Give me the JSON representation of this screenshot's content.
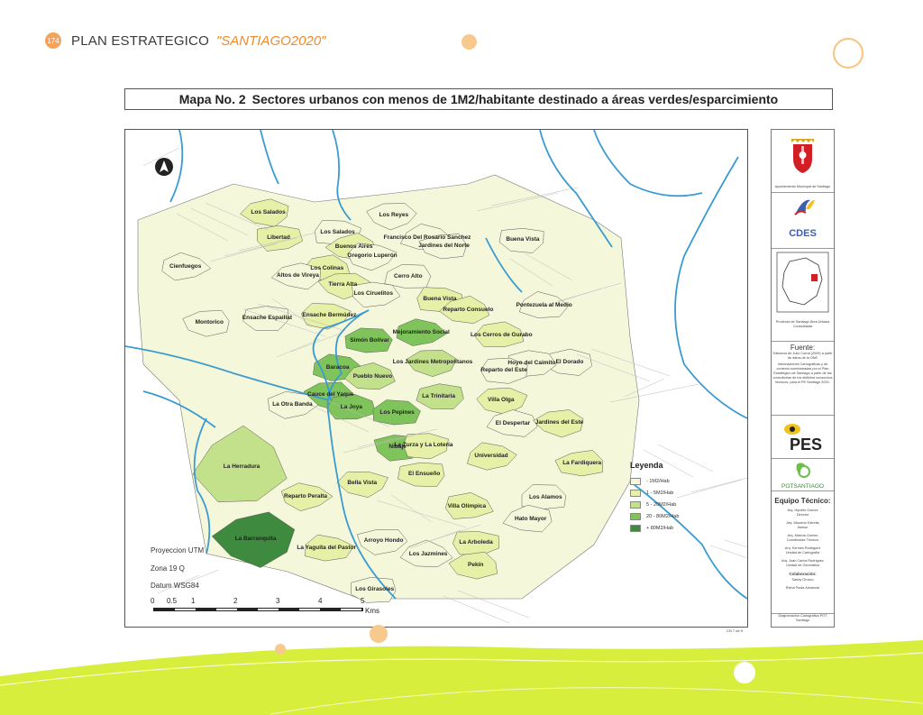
{
  "header": {
    "page_number": "174",
    "title": "PLAN ESTRATEGICO",
    "subtitle": "\"SANTIAGO2020\""
  },
  "map": {
    "title_number": "Mapa No. 2",
    "title_text": "Sectores urbanos con menos de 1M2/habitante destinado a áreas verdes/esparcimiento",
    "sectors": [
      {
        "name": "Los Salados",
        "level": 2
      },
      {
        "name": "Los Reyes",
        "level": 1
      },
      {
        "name": "Libertad",
        "level": 2
      },
      {
        "name": "Los Salados",
        "level": 1
      },
      {
        "name": "Francisco Del Rosario Sanchez",
        "level": 1
      },
      {
        "name": "Buenos Aires",
        "level": 2
      },
      {
        "name": "Jardines del Norte",
        "level": 1
      },
      {
        "name": "Buena Vista",
        "level": 1
      },
      {
        "name": "Gregorio Luperón",
        "level": 1
      },
      {
        "name": "Cienfuegos",
        "level": 1
      },
      {
        "name": "Los Colinas",
        "level": 2
      },
      {
        "name": "Cerro Alto",
        "level": 1
      },
      {
        "name": "Altos de Vireya",
        "level": 1
      },
      {
        "name": "Tierra Alta",
        "level": 2
      },
      {
        "name": "Los Ciruelitos",
        "level": 1
      },
      {
        "name": "Buena Vista",
        "level": 2
      },
      {
        "name": "Pontezuela al Medio",
        "level": 1
      },
      {
        "name": "Reparto Consuelo",
        "level": 2
      },
      {
        "name": "Montorico",
        "level": 1
      },
      {
        "name": "Ensache Espaillat",
        "level": 1
      },
      {
        "name": "Ensache Bermúdez",
        "level": 2
      },
      {
        "name": "Mejoramiento Social",
        "level": 4
      },
      {
        "name": "Los Cerros de Gurabo",
        "level": 2
      },
      {
        "name": "Simón Bolívar",
        "level": 4
      },
      {
        "name": "El Dorado",
        "level": 1
      },
      {
        "name": "Los Jardines Metropolitanos",
        "level": 3
      },
      {
        "name": "Hoyo del Caimito",
        "level": 1
      },
      {
        "name": "Reparto del Este",
        "level": 1
      },
      {
        "name": "Baracoa",
        "level": 4
      },
      {
        "name": "Pueblo Nuevo",
        "level": 3
      },
      {
        "name": "Cauce del Yaque",
        "level": 4
      },
      {
        "name": "La Trinitaria",
        "level": 3
      },
      {
        "name": "Villa Olga",
        "level": 2
      },
      {
        "name": "La Otra Banda",
        "level": 1
      },
      {
        "name": "La Joya",
        "level": 4
      },
      {
        "name": "Los Pepines",
        "level": 4
      },
      {
        "name": "El Despertar",
        "level": 1
      },
      {
        "name": "Jardines del Este",
        "level": 2
      },
      {
        "name": "Nibaje",
        "level": 4
      },
      {
        "name": "La Zurza y La Lotería",
        "level": 2
      },
      {
        "name": "Universidad",
        "level": 2
      },
      {
        "name": "La Herradura",
        "level": 3
      },
      {
        "name": "La Fardiquera",
        "level": 2
      },
      {
        "name": "El Ensueño",
        "level": 2
      },
      {
        "name": "Bella Vista",
        "level": 2
      },
      {
        "name": "Reparto Peralta",
        "level": 2
      },
      {
        "name": "Villa Olímpica",
        "level": 2
      },
      {
        "name": "Los Alamos",
        "level": 1
      },
      {
        "name": "Hato Mayor",
        "level": 1
      },
      {
        "name": "La Barranquita",
        "level": 5
      },
      {
        "name": "Arroyo Hondo",
        "level": 1
      },
      {
        "name": "La Arboleda",
        "level": 2
      },
      {
        "name": "La Yaguita del Pastor",
        "level": 2
      },
      {
        "name": "Los Jazmines",
        "level": 1
      },
      {
        "name": "Pekín",
        "level": 2
      },
      {
        "name": "Los Girasoles",
        "level": 1
      }
    ],
    "legend": {
      "title": "Leyenda",
      "items": [
        {
          "label": "- 1M2/Hab",
          "color": "#f4f7d9"
        },
        {
          "label": "1 - 5M2/Hab",
          "color": "#e6f0a6"
        },
        {
          "label": "5 - 20M2/Hab",
          "color": "#c3e08a"
        },
        {
          "label": "20 - 80M2/Hab",
          "color": "#7fc45a"
        },
        {
          "label": "+ 80M2/Hab",
          "color": "#3e8a3e"
        }
      ]
    },
    "projection": {
      "line1": "Proyeccion UTM",
      "line2": "Zona 19 Q",
      "line3": "Datum WSG84"
    },
    "scale": {
      "ticks": [
        "0",
        "0.5",
        "1",
        "2",
        "3",
        "4",
        "5"
      ],
      "unit": "Kms"
    },
    "credit": "CN 7 de 5"
  },
  "panel": {
    "logo1_caption": "Ayuntamiento Municipal de Santiago",
    "logo2_text": "CDES",
    "locator_caption": "Provincia de Santiago Área Urbana Consolidada",
    "fuente_title": "Fuente:",
    "fuente_text1": "Edesinos de Julio Corral (2009) a partir de datos de la ONE",
    "fuente_text2": "Informaciones Cartográficas y de contexto suministradas por el Plan Estratégico de Santiago a partir de las consultorías de los distintos consorcios técnicos, para el PE Santiago 2020.",
    "logo3_text": "PES",
    "logo4_text": "POTSANTIAGO",
    "team_title": "Equipo Técnico:",
    "team": [
      {
        "name": "Arq. Hipolito Gomez",
        "role": "Director"
      },
      {
        "name": "Arq. Mauricio Estrella",
        "role": "Asesor"
      },
      {
        "name": "Arq. Marcos Gomez",
        "role": "Coordinador Técnico"
      },
      {
        "name": "Arq. Kermes Rodriguez",
        "role": "Unidad de Cartografía"
      },
      {
        "name": "Arq. Juan Carlos Rodríguez",
        "role": "Unidad de Geomática"
      }
    ],
    "collab_title": "Colaboración:",
    "collab": [
      "Sandy Orozco",
      "Reina Paola Almánzar"
    ],
    "footer": "Diagramación Cartográfica POT Santiago"
  },
  "colors": {
    "accent_orange": "#f08a2a",
    "lime_wave": "#d7ee3c",
    "river": "#3b9bd1"
  }
}
